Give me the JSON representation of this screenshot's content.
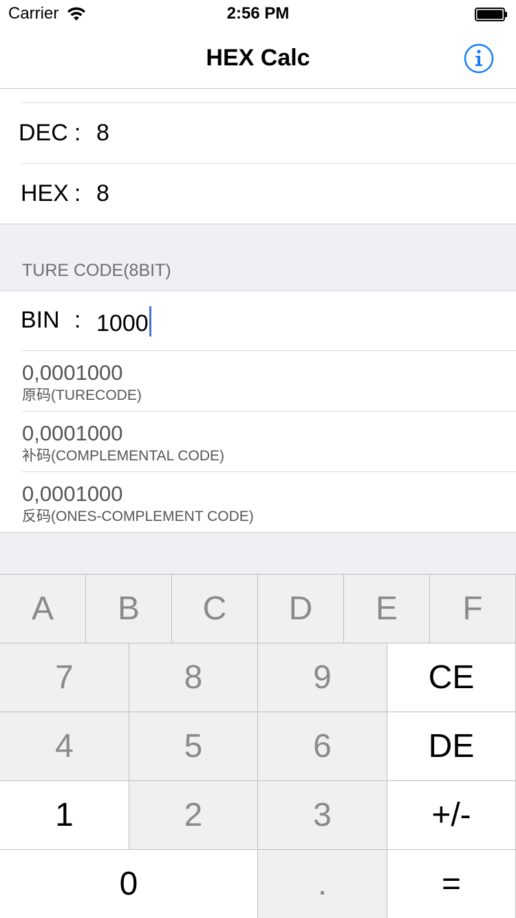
{
  "status_bar": {
    "carrier": "Carrier",
    "time": "2:56 PM"
  },
  "nav": {
    "title": "HEX Calc",
    "info_icon": "info-circle-icon",
    "accent_color": "#147efb"
  },
  "conversions": {
    "dec": {
      "label": "DEC",
      "separator": ":",
      "value": "8"
    },
    "hex": {
      "label": "HEX",
      "separator": ":",
      "value": "8"
    }
  },
  "section": {
    "header": "TURE CODE(8BIT)"
  },
  "bin": {
    "label": "BIN",
    "separator": ":",
    "value": "1000"
  },
  "codes": [
    {
      "value": "0,0001000",
      "label": "原码(TURECODE)"
    },
    {
      "value": "0,0001000",
      "label": "补码(COMPLEMENTAL CODE)"
    },
    {
      "value": "0,0001000",
      "label": "反码(ONES-COMPLEMENT CODE)"
    }
  ],
  "keypad": {
    "hex_keys": [
      "A",
      "B",
      "C",
      "D",
      "E",
      "F"
    ],
    "rows": [
      [
        "7",
        "8",
        "9",
        "CE"
      ],
      [
        "4",
        "5",
        "6",
        "DE"
      ],
      [
        "1",
        "2",
        "3",
        "+/-"
      ]
    ],
    "bottom": [
      "0",
      ".",
      "="
    ]
  }
}
